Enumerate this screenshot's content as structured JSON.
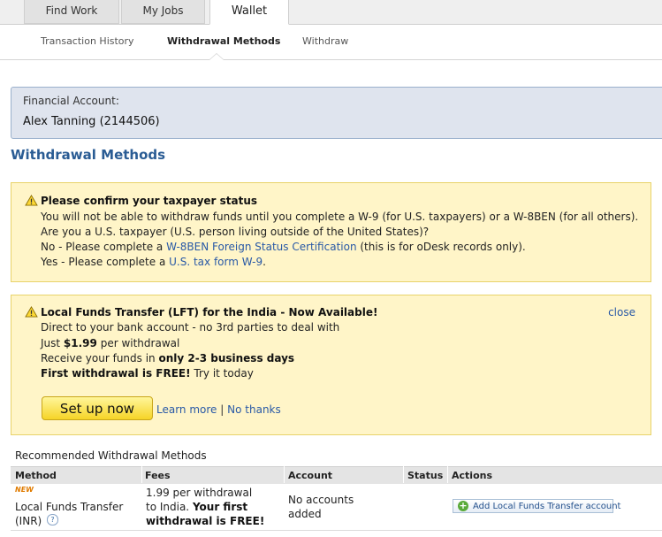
{
  "top_tabs": [
    "Find Work",
    "My Jobs",
    "Wallet"
  ],
  "sub_nav": [
    "Transaction History",
    "Withdrawal Methods",
    "Withdraw"
  ],
  "financial_account": {
    "label": "Financial Account:",
    "name": "Alex Tanning (2144506)"
  },
  "page_title": "Withdrawal Methods",
  "tax_notice": {
    "title": "Please confirm your taxpayer status",
    "line1": "You will not be able to withdraw funds until you complete a W-9 (for U.S. taxpayers) or a W-8BEN (for all others).",
    "line2": "Are you a U.S. taxpayer (U.S. person living outside of the United States)?",
    "no_prefix": "No - Please complete a ",
    "no_link": "W-8BEN Foreign Status Certification",
    "no_suffix": " (this is for oDesk records only).",
    "yes_prefix": "Yes - Please complete a ",
    "yes_link": "U.S. tax form W-9",
    "yes_suffix": "."
  },
  "lft_notice": {
    "title": "Local Funds Transfer (LFT) for the India - Now Available!",
    "close": "close",
    "line1": "Direct to your bank account - no 3rd parties to deal with",
    "line2_prefix": "Just ",
    "line2_price": "$1.99",
    "line2_suffix": " per withdrawal",
    "line3_prefix": "Receive your funds in ",
    "line3_bold": "only 2-3 business days",
    "line4_bold": "First withdrawal is FREE!",
    "line4_suffix": " Try it today",
    "setup_button": "Set up now",
    "learn_more": "Learn more",
    "separator": "|",
    "no_thanks": "No thanks"
  },
  "recommended": {
    "heading": "Recommended Withdrawal Methods",
    "columns": [
      "Method",
      "Fees",
      "Account",
      "Status",
      "Actions"
    ],
    "row": {
      "badge": "NEW",
      "method_line1": "Local Funds Transfer",
      "method_line2": "(INR)",
      "help": "?",
      "fees_line1": "1.99 per withdrawal",
      "fees_line2_prefix": "to India. ",
      "fees_line2_bold": "Your first",
      "fees_line3_bold": "withdrawal is FREE!",
      "account_line1": "No accounts",
      "account_line2": "added",
      "status": "",
      "action_button": "Add Local Funds Transfer account"
    }
  },
  "colors": {
    "accent": "#2a5c94",
    "notice_bg": "#fff5c8",
    "account_bg": "#dfe4ee"
  },
  "icons": [
    "warning-icon",
    "plus-circle-icon",
    "help-icon"
  ]
}
